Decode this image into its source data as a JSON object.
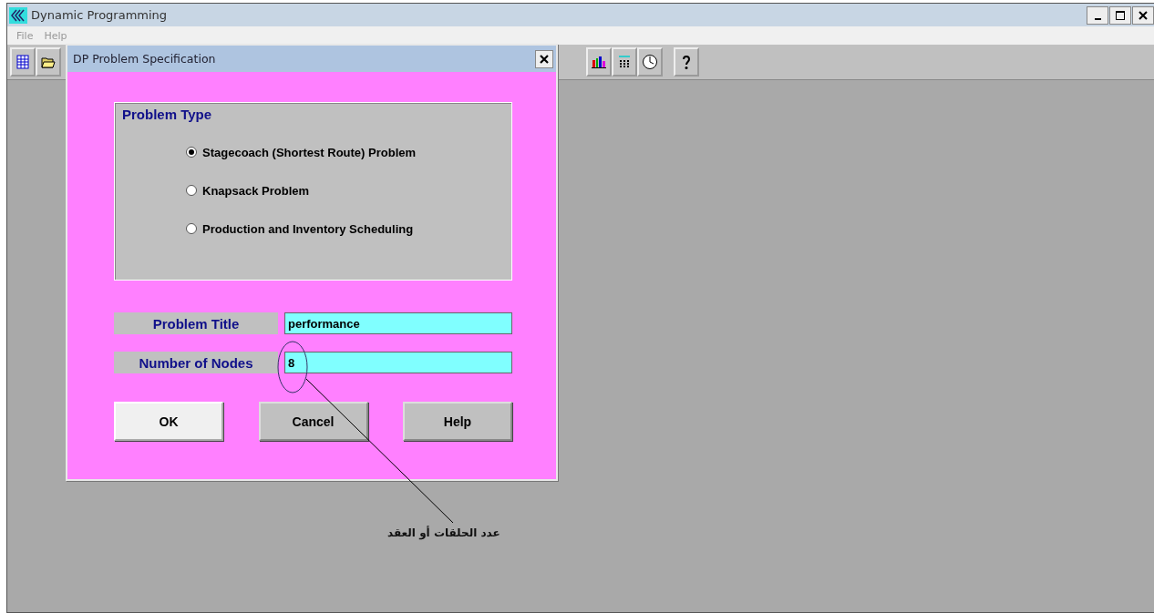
{
  "window": {
    "title": "Dynamic Programming"
  },
  "menu": [
    "File",
    "Help"
  ],
  "dialog": {
    "title": "DP Problem Specification",
    "problem_type": {
      "legend": "Problem Type",
      "options": [
        {
          "label": "Stagecoach (Shortest Route) Problem",
          "selected": true
        },
        {
          "label": "Knapsack Problem",
          "selected": false
        },
        {
          "label": "Production and Inventory Scheduling",
          "selected": false
        }
      ]
    },
    "fields": [
      {
        "label": "Problem Title",
        "value": "performance"
      },
      {
        "label": "Number of Nodes",
        "value": "8"
      }
    ],
    "buttons": [
      {
        "label": "OK",
        "default": true
      },
      {
        "label": "Cancel",
        "default": false
      },
      {
        "label": "Help",
        "default": false
      }
    ]
  },
  "annotation": {
    "text": "عدد الحلقات أو العقد"
  }
}
